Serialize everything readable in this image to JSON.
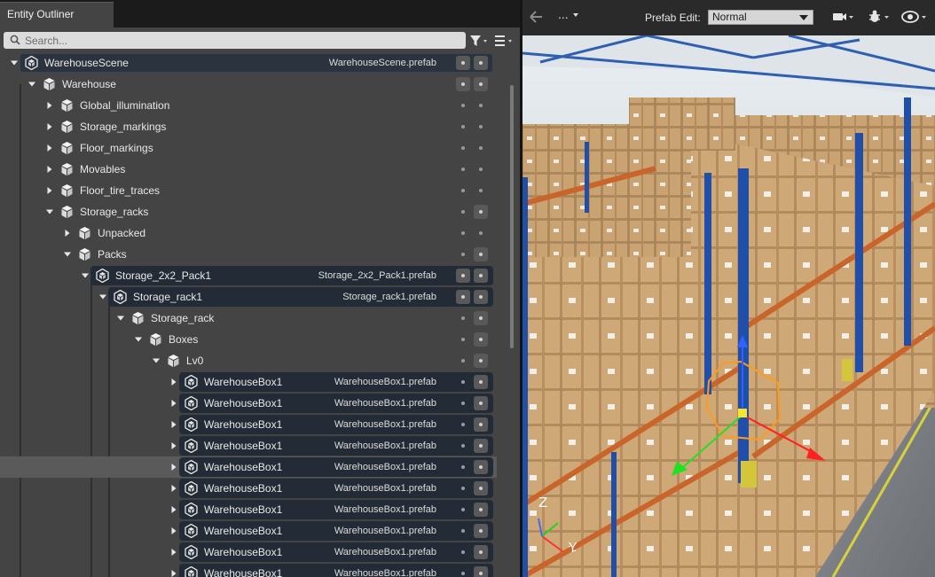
{
  "panel": {
    "tab_title": "Entity Outliner",
    "search_placeholder": "Search..."
  },
  "tree": [
    {
      "name": "WarehouseScene",
      "prefab": "WarehouseScene.prefab",
      "depth": 0,
      "expanded": true,
      "kind": "prefab-root"
    },
    {
      "name": "Warehouse",
      "prefab": "",
      "depth": 1,
      "expanded": true,
      "kind": "entity"
    },
    {
      "name": "Global_illumination",
      "prefab": "",
      "depth": 2,
      "expanded": false,
      "kind": "entity"
    },
    {
      "name": "Storage_markings",
      "prefab": "",
      "depth": 2,
      "expanded": false,
      "kind": "entity"
    },
    {
      "name": "Floor_markings",
      "prefab": "",
      "depth": 2,
      "expanded": false,
      "kind": "entity"
    },
    {
      "name": "Movables",
      "prefab": "",
      "depth": 2,
      "expanded": false,
      "kind": "entity"
    },
    {
      "name": "Floor_tire_traces",
      "prefab": "",
      "depth": 2,
      "expanded": false,
      "kind": "entity"
    },
    {
      "name": "Storage_racks",
      "prefab": "",
      "depth": 2,
      "expanded": true,
      "kind": "entity"
    },
    {
      "name": "Unpacked",
      "prefab": "",
      "depth": 3,
      "expanded": false,
      "kind": "entity"
    },
    {
      "name": "Packs",
      "prefab": "",
      "depth": 3,
      "expanded": true,
      "kind": "entity"
    },
    {
      "name": "Storage_2x2_Pack1",
      "prefab": "Storage_2x2_Pack1.prefab",
      "depth": 4,
      "expanded": true,
      "kind": "prefab"
    },
    {
      "name": "Storage_rack1",
      "prefab": "Storage_rack1.prefab",
      "depth": 5,
      "expanded": true,
      "kind": "prefab"
    },
    {
      "name": "Storage_rack",
      "prefab": "",
      "depth": 6,
      "expanded": true,
      "kind": "entity"
    },
    {
      "name": "Boxes",
      "prefab": "",
      "depth": 7,
      "expanded": true,
      "kind": "entity"
    },
    {
      "name": "Lv0",
      "prefab": "",
      "depth": 8,
      "expanded": true,
      "kind": "entity"
    },
    {
      "name": "WarehouseBox1",
      "prefab": "WarehouseBox1.prefab",
      "depth": 9,
      "expanded": false,
      "kind": "prefab"
    },
    {
      "name": "WarehouseBox1",
      "prefab": "WarehouseBox1.prefab",
      "depth": 9,
      "expanded": false,
      "kind": "prefab"
    },
    {
      "name": "WarehouseBox1",
      "prefab": "WarehouseBox1.prefab",
      "depth": 9,
      "expanded": false,
      "kind": "prefab"
    },
    {
      "name": "WarehouseBox1",
      "prefab": "WarehouseBox1.prefab",
      "depth": 9,
      "expanded": false,
      "kind": "prefab"
    },
    {
      "name": "WarehouseBox1",
      "prefab": "WarehouseBox1.prefab",
      "depth": 9,
      "expanded": false,
      "kind": "prefab",
      "hovered": true
    },
    {
      "name": "WarehouseBox1",
      "prefab": "WarehouseBox1.prefab",
      "depth": 9,
      "expanded": false,
      "kind": "prefab"
    },
    {
      "name": "WarehouseBox1",
      "prefab": "WarehouseBox1.prefab",
      "depth": 9,
      "expanded": false,
      "kind": "prefab"
    },
    {
      "name": "WarehouseBox1",
      "prefab": "WarehouseBox1.prefab",
      "depth": 9,
      "expanded": false,
      "kind": "prefab"
    },
    {
      "name": "WarehouseBox1",
      "prefab": "WarehouseBox1.prefab",
      "depth": 9,
      "expanded": false,
      "kind": "prefab"
    },
    {
      "name": "WarehouseBox1",
      "prefab": "WarehouseBox1.prefab",
      "depth": 9,
      "expanded": false,
      "kind": "prefab"
    }
  ],
  "viewport": {
    "dots_label": "...",
    "prefab_edit_label": "Prefab Edit:",
    "prefab_edit_value": "Normal",
    "axis_z": "Z",
    "axis_y": "Y"
  }
}
